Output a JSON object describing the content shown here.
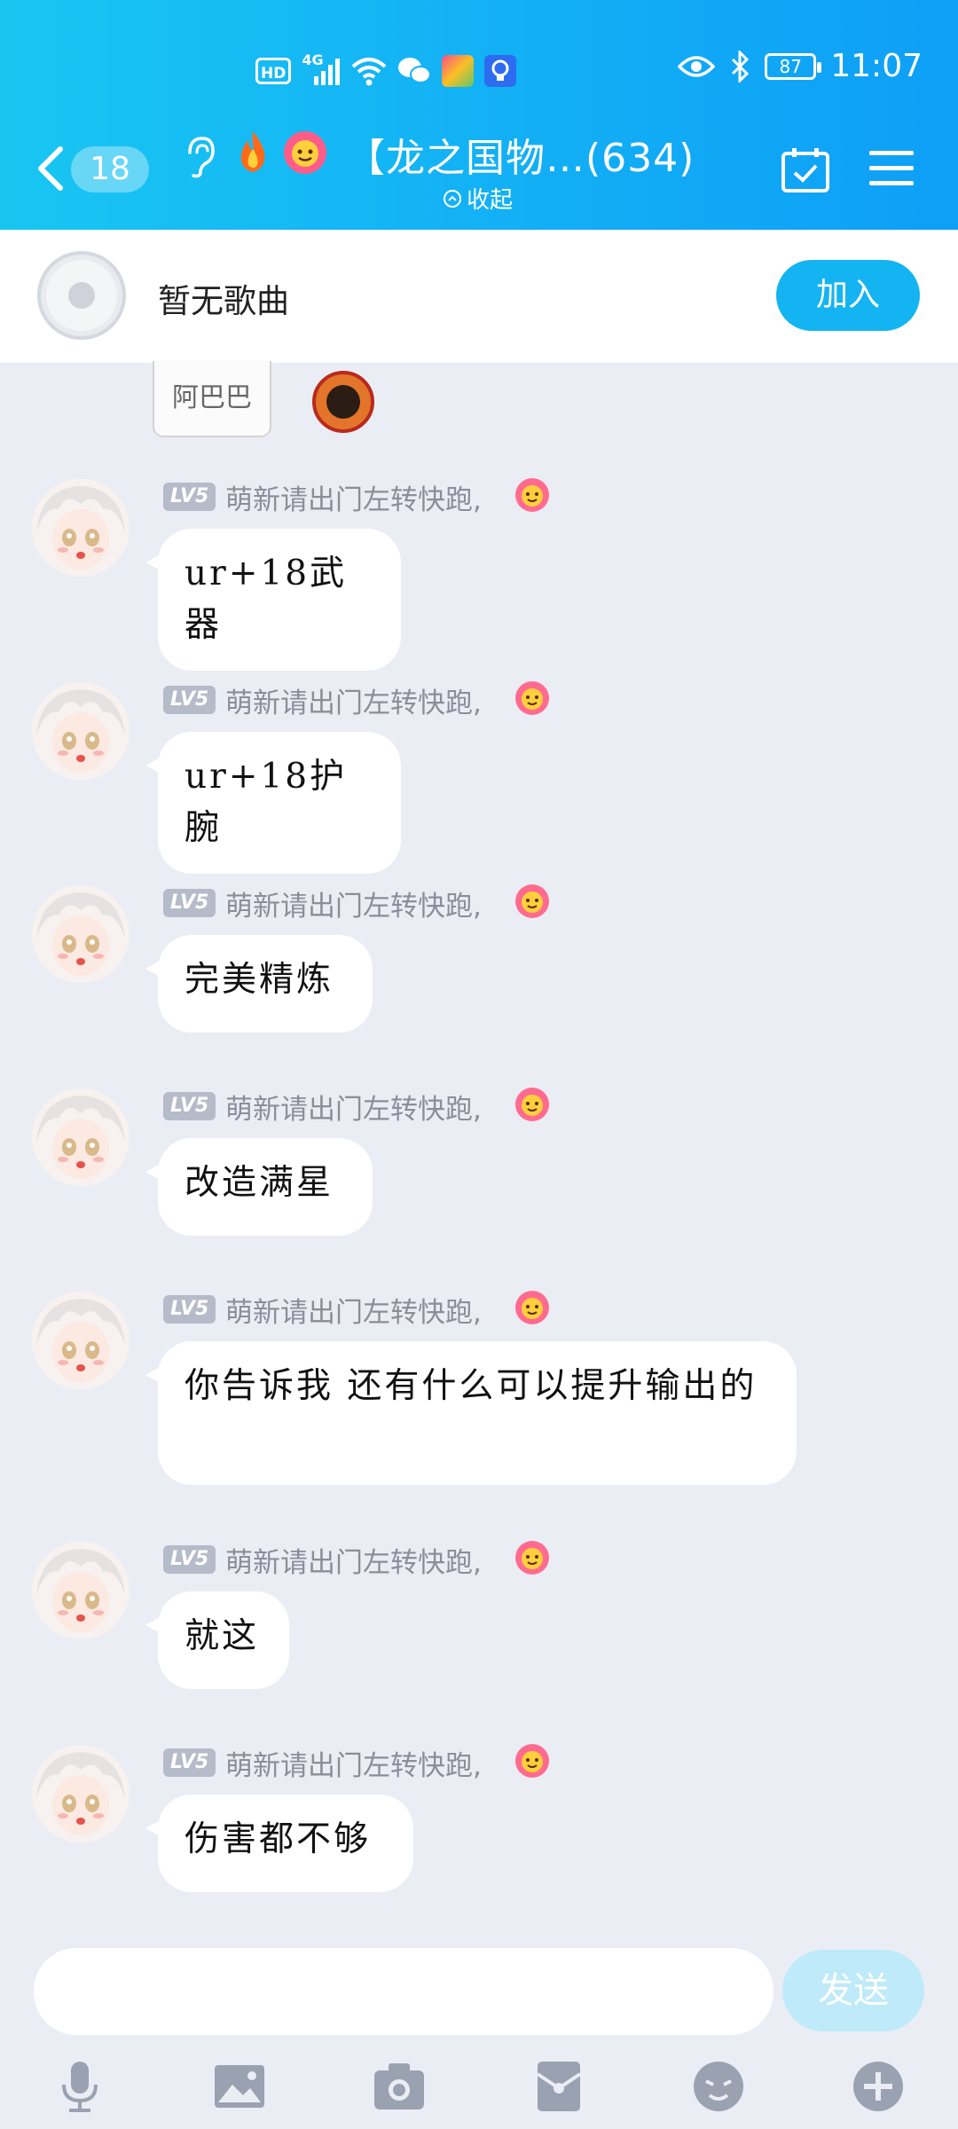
{
  "status_bar": {
    "hd": "HD",
    "network": "4G",
    "battery": "87",
    "time": "11:07"
  },
  "header": {
    "unread_count": "18",
    "title": "【龙之国物…(634)",
    "collapse_label": "收起"
  },
  "music": {
    "text": "暂无歌曲",
    "join_label": "加入"
  },
  "prev_sticker": {
    "text": "阿巴巴"
  },
  "messages": [
    {
      "level": "LV5",
      "nickname": "萌新请出门左转快跑,",
      "text": "ur+18武器"
    },
    {
      "level": "LV5",
      "nickname": "萌新请出门左转快跑,",
      "text": "ur+18护腕"
    },
    {
      "level": "LV5",
      "nickname": "萌新请出门左转快跑,",
      "text": "完美精炼"
    },
    {
      "level": "LV5",
      "nickname": "萌新请出门左转快跑,",
      "text": "改造满星"
    },
    {
      "level": "LV5",
      "nickname": "萌新请出门左转快跑,",
      "text": "你告诉我 还有什么可以提升输出的"
    },
    {
      "level": "LV5",
      "nickname": "萌新请出门左转快跑,",
      "text": "就这"
    },
    {
      "level": "LV5",
      "nickname": "萌新请出门左转快跑,",
      "text": "伤害都不够"
    }
  ],
  "input": {
    "value": "",
    "send_label": "发送"
  },
  "colors": {
    "header_start": "#19c6f2",
    "header_end": "#0e9ff6",
    "accent": "#14b4f2",
    "chat_bg": "#ebedf5",
    "send_disabled": "#bfeaf9"
  },
  "toolbar_icons": [
    "microphone-icon",
    "image-icon",
    "camera-icon",
    "red-packet-icon",
    "emoji-icon",
    "plus-icon"
  ]
}
